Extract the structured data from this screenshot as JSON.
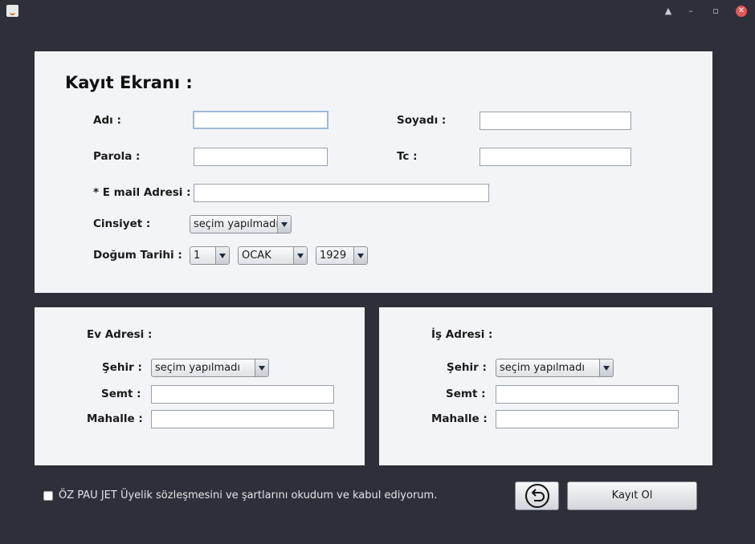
{
  "window": {
    "controls": [
      "▲",
      "–",
      "▫",
      "✕"
    ]
  },
  "form": {
    "title": "Kayıt Ekranı :",
    "labels": {
      "ad": "Adı :",
      "soyad": "Soyadı :",
      "parola": "Parola :",
      "tc": "Tc :",
      "email": "* E mail Adresi :",
      "cinsiyet": "Cinsiyet :",
      "dogum": "Doğum Tarihi :"
    },
    "values": {
      "ad": "",
      "soyad": "",
      "parola": "",
      "tc": "",
      "email": ""
    },
    "cinsiyet_selected": "seçim yapılmadı",
    "dogum": {
      "day": "1",
      "month": "OCAK",
      "year": "1929"
    }
  },
  "ev_adresi": {
    "title": "Ev Adresi :",
    "sehir_label": "Şehir :",
    "sehir_selected": "seçim yapılmadı",
    "semt_label": "Semt :",
    "mahalle_label": "Mahalle :"
  },
  "is_adresi": {
    "title": "İş Adresi :",
    "sehir_label": "Şehir :",
    "sehir_selected": "seçim yapılmadı",
    "semt_label": "Semt :",
    "mahalle_label": "Mahalle :"
  },
  "footer": {
    "agreement": "ÖZ PAU JET Üyelik sözleşmesini ve şartlarını okudum ve kabul ediyorum.",
    "agreement_checked": false,
    "back_icon": "undo-arrow-icon",
    "register_label": "Kayıt Ol"
  }
}
